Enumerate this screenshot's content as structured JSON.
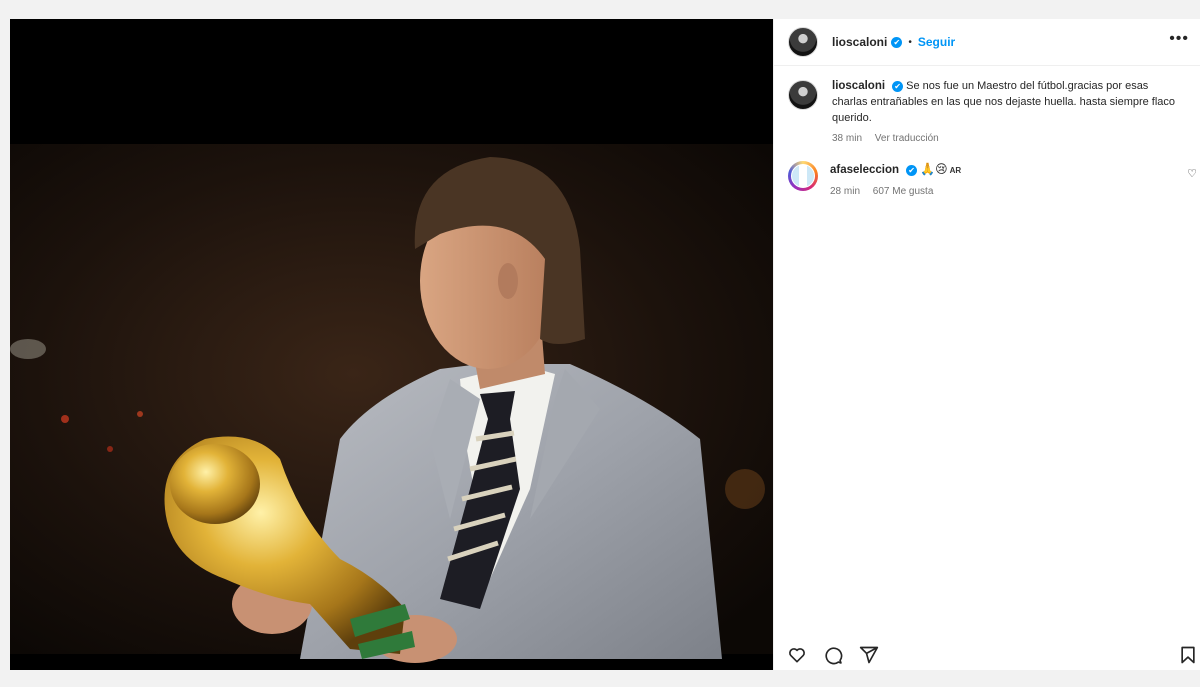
{
  "post": {
    "author": "lioscaloni",
    "follow_label": "Seguir",
    "separator": "•",
    "more_label": "•••"
  },
  "caption": {
    "username": "lioscaloni",
    "text": "Se nos fue un Maestro del fútbol.gracias por esas charlas entrañables en las que nos dejaste huella. hasta siempre flaco querido.",
    "time": "38 min",
    "translate_label": "Ver traducción"
  },
  "comments": [
    {
      "username": "afaseleccion",
      "text": "🙏😢",
      "flag_label": "AR",
      "time": "28 min",
      "likes": "607 Me gusta"
    }
  ],
  "icons": {
    "verified": "✔",
    "like": "heart-icon",
    "comment": "comment-icon",
    "share": "share-icon",
    "save": "bookmark-icon",
    "small_like": "♡"
  },
  "colors": {
    "accent": "#0095f6",
    "muted": "#737373"
  }
}
